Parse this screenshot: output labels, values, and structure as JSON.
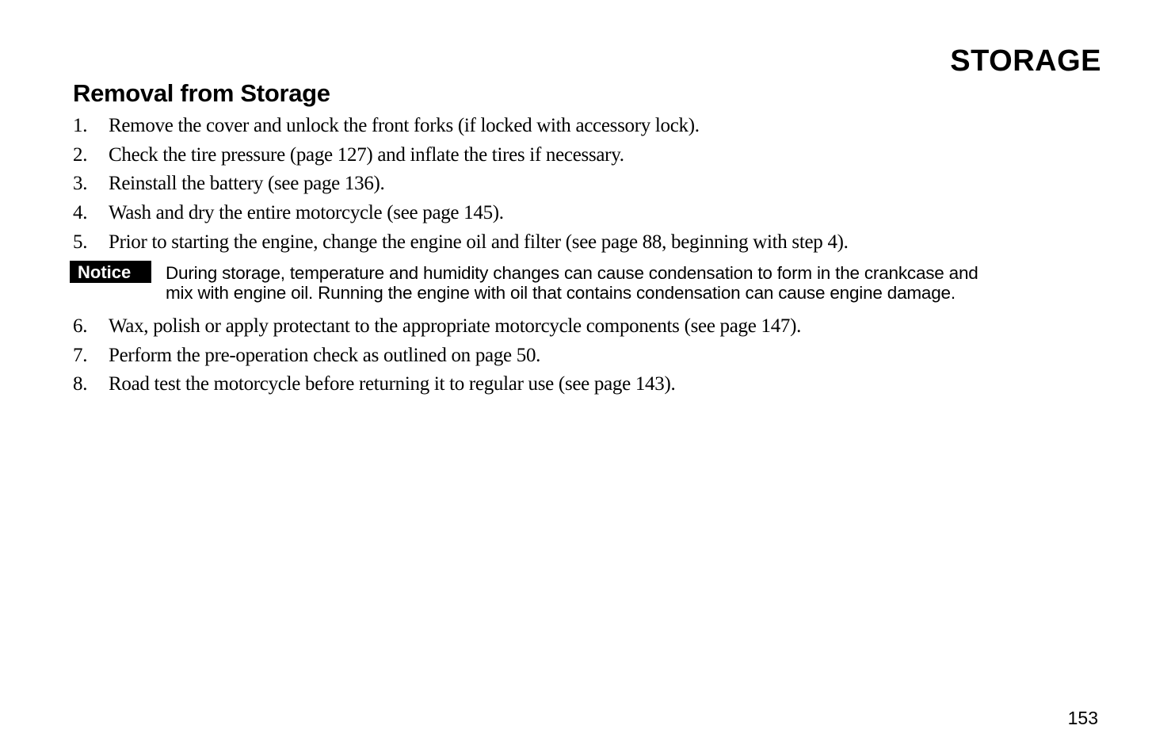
{
  "section_title": "STORAGE",
  "heading": "Removal from Storage",
  "steps_before_notice": [
    {
      "num": "1.",
      "text": "Remove the cover and unlock the front forks (if locked with accessory lock)."
    },
    {
      "num": "2.",
      "text": "Check the tire pressure (page 127) and inflate the tires if necessary."
    },
    {
      "num": "3.",
      "text": "Reinstall the battery (see page 136)."
    },
    {
      "num": "4.",
      "text": "Wash and dry the entire motorcycle (see page 145)."
    },
    {
      "num": "5.",
      "text": "Prior to starting the engine, change the engine oil and filter (see page 88, beginning with step 4)."
    }
  ],
  "notice": {
    "label": "Notice",
    "lines": [
      "During storage, temperature and humidity changes can cause condensation to form in the crankcase and",
      "mix with engine oil. Running the engine with oil that contains condensation can cause engine damage."
    ]
  },
  "steps_after_notice": [
    {
      "num": "6.",
      "text": "Wax, polish or apply protectant to the appropriate motorcycle components (see page 147)."
    },
    {
      "num": "7.",
      "text": "Perform the pre-operation check as outlined on page 50."
    },
    {
      "num": "8.",
      "text": "Road test the motorcycle before returning it to regular use (see page 143)."
    }
  ],
  "page_number": "153"
}
